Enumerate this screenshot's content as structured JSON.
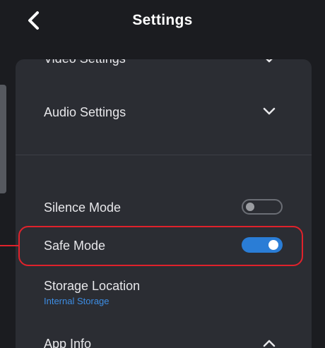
{
  "header": {
    "title": "Settings",
    "back_icon": "chevron-left-icon"
  },
  "settings": {
    "video": {
      "label": "Video Settings",
      "icon": "chevron-down-icon"
    },
    "audio": {
      "label": "Audio Settings",
      "icon": "chevron-down-icon"
    },
    "silence_mode": {
      "label": "Silence Mode",
      "enabled": false
    },
    "safe_mode": {
      "label": "Safe Mode",
      "enabled": true
    },
    "storage_location": {
      "label": "Storage Location",
      "value": "Internal Storage"
    },
    "app_info": {
      "label": "App Info",
      "icon": "chevron-up-icon"
    }
  },
  "colors": {
    "background": "#1b1c20",
    "panel": "#2b2d33",
    "accent": "#2a7dd6",
    "highlight": "#e0222b",
    "link": "#3d8de3"
  }
}
